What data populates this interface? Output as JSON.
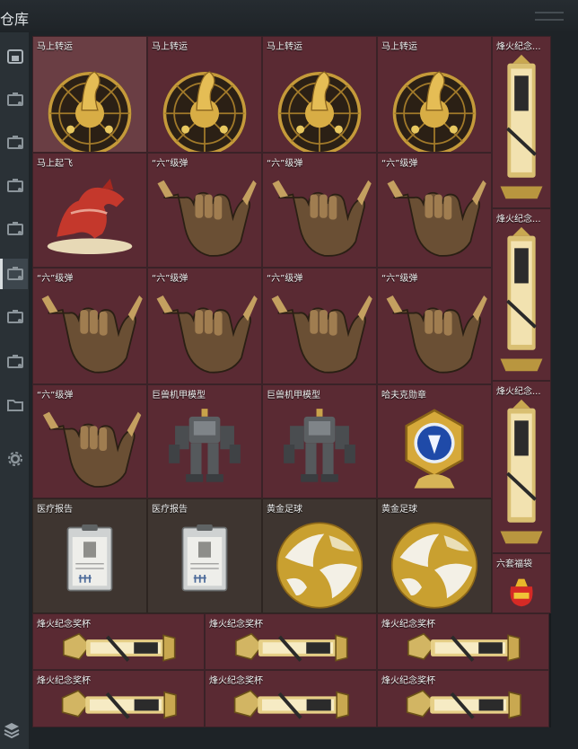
{
  "window": {
    "title": "仓库"
  },
  "sidebar": {
    "items": [
      {
        "icon": "box-icon"
      },
      {
        "icon": "case-icon"
      },
      {
        "icon": "case-icon"
      },
      {
        "icon": "case-icon"
      },
      {
        "icon": "case-icon"
      },
      {
        "icon": "case-icon",
        "active": true
      },
      {
        "icon": "case-icon"
      },
      {
        "icon": "case-icon"
      },
      {
        "icon": "folder-icon"
      },
      {
        "icon": "gear-icon"
      }
    ],
    "bottom_icon": "layers-icon"
  },
  "items": [
    {
      "label": "马上转运",
      "kind": "wheel"
    },
    {
      "label": "马上转运",
      "kind": "wheel"
    },
    {
      "label": "马上转运",
      "kind": "wheel"
    },
    {
      "label": "马上转运",
      "kind": "wheel"
    },
    {
      "label": "烽火纪念...",
      "kind": "trophy-tall"
    },
    {
      "label": "马上起飞",
      "kind": "horse"
    },
    {
      "label": "“六”级弹",
      "kind": "hand"
    },
    {
      "label": "“六”级弹",
      "kind": "hand"
    },
    {
      "label": "“六”级弹",
      "kind": "hand"
    },
    {
      "label": "烽火纪念...",
      "kind": "trophy-tall"
    },
    {
      "label": "“六”级弹",
      "kind": "hand"
    },
    {
      "label": "“六”级弹",
      "kind": "hand"
    },
    {
      "label": "“六”级弹",
      "kind": "hand"
    },
    {
      "label": "“六”级弹",
      "kind": "hand"
    },
    {
      "label": "“六”级弹",
      "kind": "hand"
    },
    {
      "label": "巨兽机甲模型",
      "kind": "mech"
    },
    {
      "label": "巨兽机甲模型",
      "kind": "mech"
    },
    {
      "label": "哈夫克勋章",
      "kind": "medal"
    },
    {
      "label": "烽火纪念...",
      "kind": "trophy-tall"
    },
    {
      "label": "医疗报告",
      "kind": "clipboard"
    },
    {
      "label": "医疗报告",
      "kind": "clipboard"
    },
    {
      "label": "黄金足球",
      "kind": "ball"
    },
    {
      "label": "黄金足球",
      "kind": "ball"
    },
    {
      "label": "六套福袋",
      "kind": "bag"
    },
    {
      "label": "烽火纪念奖杯",
      "kind": "trophy-wide"
    },
    {
      "label": "烽火纪念奖杯",
      "kind": "trophy-wide"
    },
    {
      "label": "烽火纪念奖杯",
      "kind": "trophy-wide"
    },
    {
      "label": "烽火纪念奖杯",
      "kind": "trophy-wide"
    },
    {
      "label": "烽火纪念奖杯",
      "kind": "trophy-wide"
    },
    {
      "label": "烽火纪念奖杯",
      "kind": "trophy-wide"
    }
  ]
}
